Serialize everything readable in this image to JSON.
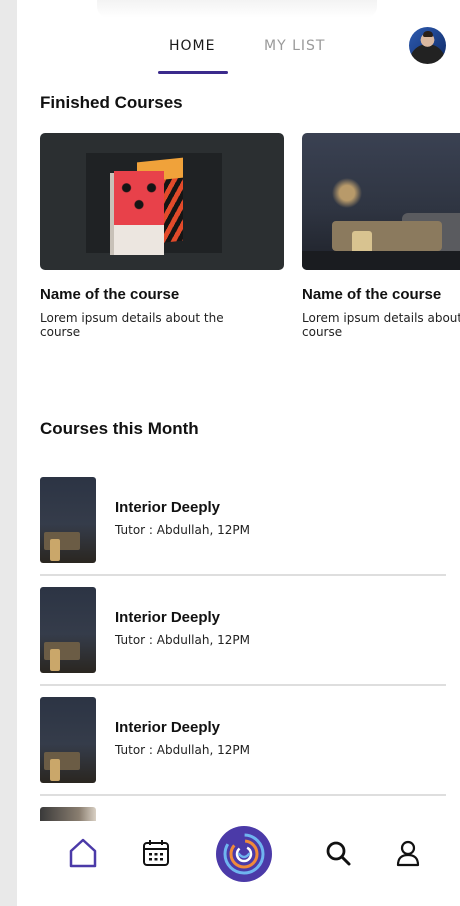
{
  "tabs": {
    "home": "HOME",
    "my_list": "MY LIST",
    "active": "home"
  },
  "finished": {
    "title": "Finished Courses",
    "cards": [
      {
        "title": "Name of the course",
        "desc": "Lorem ipsum details about the course",
        "image": "books-image"
      },
      {
        "title": "Name of the course",
        "desc": "Lorem ipsum details about the course",
        "image": "interior-image"
      }
    ]
  },
  "month": {
    "title": "Courses this Month",
    "items": [
      {
        "title": "Interior Deeply",
        "sub": "Tutor : Abdullah, 12PM"
      },
      {
        "title": "Interior Deeply",
        "sub": "Tutor : Abdullah, 12PM"
      },
      {
        "title": "Interior Deeply",
        "sub": "Tutor : Abdullah, 12PM"
      }
    ]
  },
  "nav": {
    "items": [
      "home-icon",
      "calendar-icon",
      "center-logo-icon",
      "search-icon",
      "profile-icon"
    ],
    "active": "home-icon"
  },
  "colors": {
    "accent": "#4b3aa8",
    "tab_underline": "#3b2a8c",
    "inactive_tab": "#9a9a9a",
    "logo_orange": "#f08a3a",
    "logo_blue": "#6fb4f0"
  }
}
